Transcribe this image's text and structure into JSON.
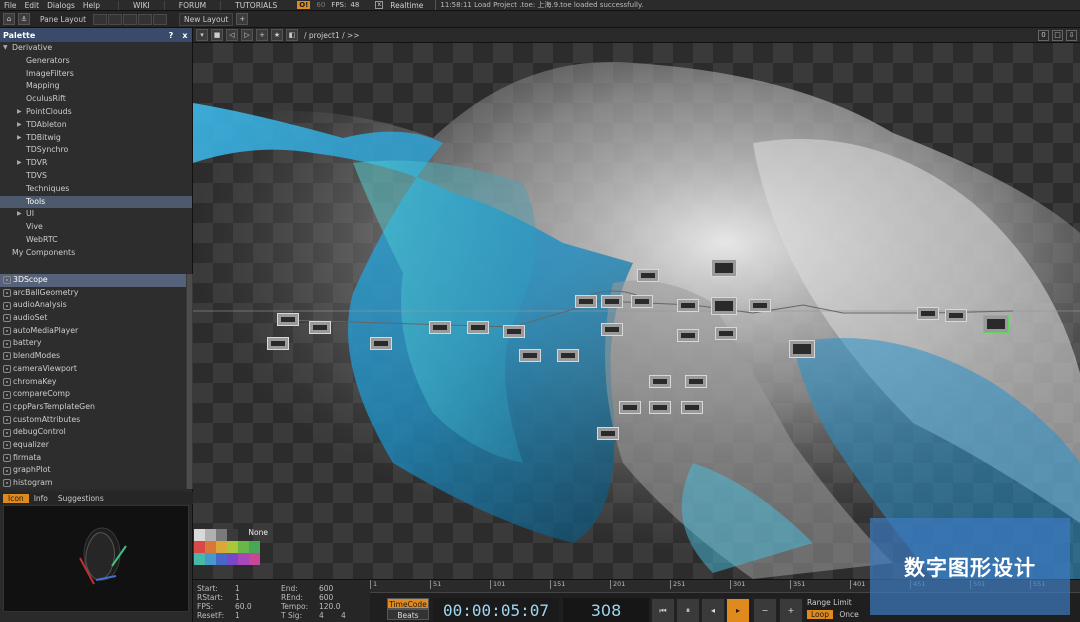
{
  "menu": {
    "items": [
      "File",
      "Edit",
      "Dialogs",
      "Help"
    ],
    "wiki": "WIKI",
    "forum": "FORUM",
    "tutorials": "TUTORIALS",
    "perf_badge": "O!",
    "perf_value": "60",
    "fps_label": "FPS:",
    "fps_value": "48",
    "realtime_label": "Realtime",
    "status_message": "11:58:11 Load Project .toe: 上海.9.toe loaded successfully."
  },
  "layoutbar": {
    "pane_layout": "Pane Layout",
    "new_layout": "New Layout",
    "add": "+"
  },
  "palette": {
    "title": "Palette",
    "help": "?",
    "close": "x",
    "tree": [
      {
        "label": "Derivative",
        "indent": 0,
        "arrow": "down"
      },
      {
        "label": "Generators",
        "indent": 2,
        "arrow": ""
      },
      {
        "label": "ImageFilters",
        "indent": 2,
        "arrow": ""
      },
      {
        "label": "Mapping",
        "indent": 2,
        "arrow": ""
      },
      {
        "label": "OculusRift",
        "indent": 2,
        "arrow": ""
      },
      {
        "label": "PointClouds",
        "indent": 2,
        "arrow": "right"
      },
      {
        "label": "TDAbleton",
        "indent": 2,
        "arrow": "right"
      },
      {
        "label": "TDBitwig",
        "indent": 2,
        "arrow": "right"
      },
      {
        "label": "TDSynchro",
        "indent": 2,
        "arrow": ""
      },
      {
        "label": "TDVR",
        "indent": 2,
        "arrow": "right"
      },
      {
        "label": "TDVS",
        "indent": 2,
        "arrow": ""
      },
      {
        "label": "Techniques",
        "indent": 2,
        "arrow": ""
      },
      {
        "label": "Tools",
        "indent": 2,
        "arrow": "",
        "selected": true
      },
      {
        "label": "UI",
        "indent": 2,
        "arrow": "right"
      },
      {
        "label": "Vive",
        "indent": 2,
        "arrow": ""
      },
      {
        "label": "WebRTC",
        "indent": 2,
        "arrow": ""
      },
      {
        "label": "My Components",
        "indent": 1,
        "arrow": ""
      }
    ],
    "components": [
      "3DScope",
      "arcBallGeometry",
      "audioAnalysis",
      "audioSet",
      "autoMediaPlayer",
      "battery",
      "blendModes",
      "cameraViewport",
      "chromaKey",
      "compareComp",
      "cppParsTemplateGen",
      "customAttributes",
      "debugControl",
      "equalizer",
      "firmata",
      "graphPlot",
      "histogram"
    ],
    "tabs": [
      "Icon",
      "Info",
      "Suggestions"
    ]
  },
  "network": {
    "path": "/ project1 / >>",
    "zero_btn": "0"
  },
  "swatch": {
    "none_label": "None",
    "colors": [
      "#d9d9d9",
      "#b0b0b0",
      "#7a7a7a",
      "#3a3a3a",
      "#d84848",
      "#d87838",
      "#d8a838",
      "#a8c838",
      "#68b848",
      "#48a858",
      "#48b8a8",
      "#4898c8",
      "#4868c8",
      "#7848c8",
      "#a848b8",
      "#c84898"
    ]
  },
  "timeline": {
    "start_label": "Start:",
    "start": "1",
    "end_label": "End:",
    "end": "600",
    "rstart_label": "RStart:",
    "rstart": "1",
    "rend_label": "REnd:",
    "rend": "600",
    "fps_label": "FPS:",
    "fps": "60.0",
    "tempo_label": "Tempo:",
    "tempo": "120.0",
    "resetf_label": "ResetF:",
    "resetf": "1",
    "tsig_label": "T Sig:",
    "tsig_a": "4",
    "tsig_b": "4",
    "ticks": [
      "1",
      "51",
      "101",
      "151",
      "201",
      "251",
      "301",
      "351",
      "401",
      "451",
      "501",
      "551"
    ],
    "mode_timecode": "TimeCode",
    "mode_beats": "Beats",
    "timecode": "00:00:05:07",
    "frame": "308",
    "range_limit": "Range Limit",
    "loop": "Loop",
    "once": "Once"
  },
  "watermark": "数字图形设计"
}
